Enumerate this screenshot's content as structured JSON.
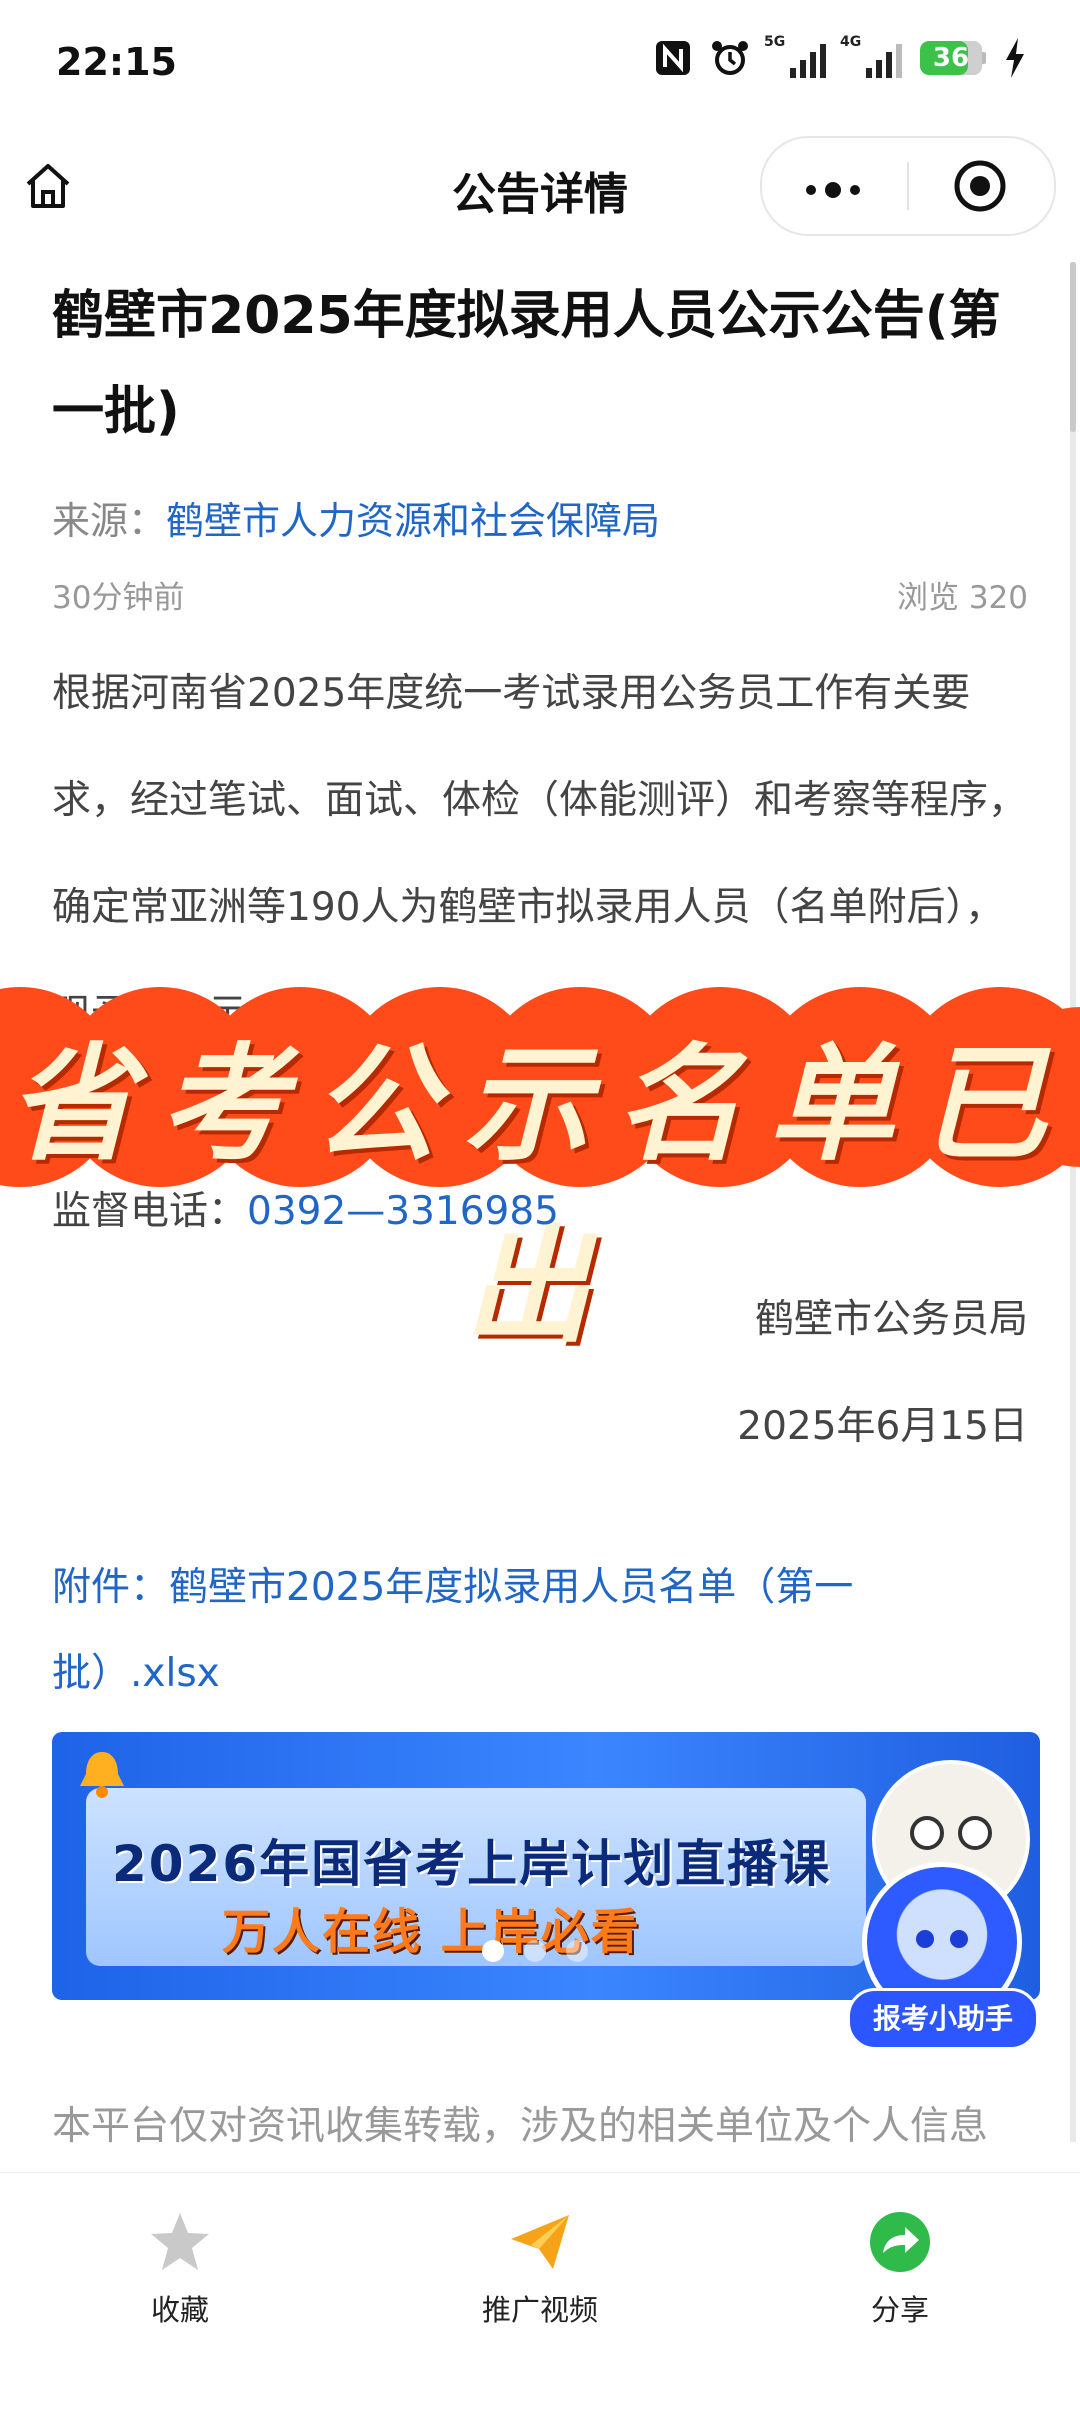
{
  "status_bar": {
    "time": "22:15",
    "battery": "36",
    "signal1_label": "5G",
    "signal2_label": "4G",
    "icons": [
      "nfc-icon",
      "alarm-icon",
      "signal-icon",
      "signal-icon",
      "battery-icon",
      "charging-icon"
    ]
  },
  "nav": {
    "title": "公告详情",
    "home_icon": "home-icon",
    "more_icon": "more-icon",
    "close_icon": "target-icon"
  },
  "article": {
    "title": "鹤壁市2025年度拟录用人员公示公告(第一批)",
    "source_label": "来源：",
    "source_org": "鹤壁市人力资源和社会保障局",
    "time_ago": "30分钟前",
    "views": "浏览 320",
    "body": "根据河南省2025年度统一考试录用公务员工作有关要求，经过笔试、面试、体检（体能测评）和考察等程序，确定常亚洲等190人为鹤壁市拟录用人员（名单附后），现予以公示。",
    "phone_label": "监督电话：",
    "phone_number": "0392—3316985",
    "sign_org": "鹤壁市公务员局",
    "sign_date": "2025年6月15日",
    "attachment": "附件：鹤壁市2025年度拟录用人员名单（第一批）.xlsx",
    "disclaimer": "本平台仅对资讯收集转载，涉及的相关单位及个人信息"
  },
  "overlay": {
    "text": "省考公示名单已出",
    "color": "#ff4a1a"
  },
  "banner": {
    "line1": "2026年国省考上岸计划直播课",
    "line2": "万人在线 上岸必看",
    "active_slide": 1,
    "slide_count": 3,
    "helper_label": "报考小助手"
  },
  "tabbar": {
    "items": [
      {
        "label": "收藏",
        "icon": "star-icon"
      },
      {
        "label": "推广视频",
        "icon": "paper-plane-icon"
      },
      {
        "label": "分享",
        "icon": "share-icon"
      }
    ]
  },
  "colors": {
    "link": "#1f66c7",
    "overlay_bubble": "#ff4a1a",
    "banner_blue": "#2c6cf0",
    "share_green": "#2fba4a",
    "plane_orange": "#f7a31a"
  }
}
